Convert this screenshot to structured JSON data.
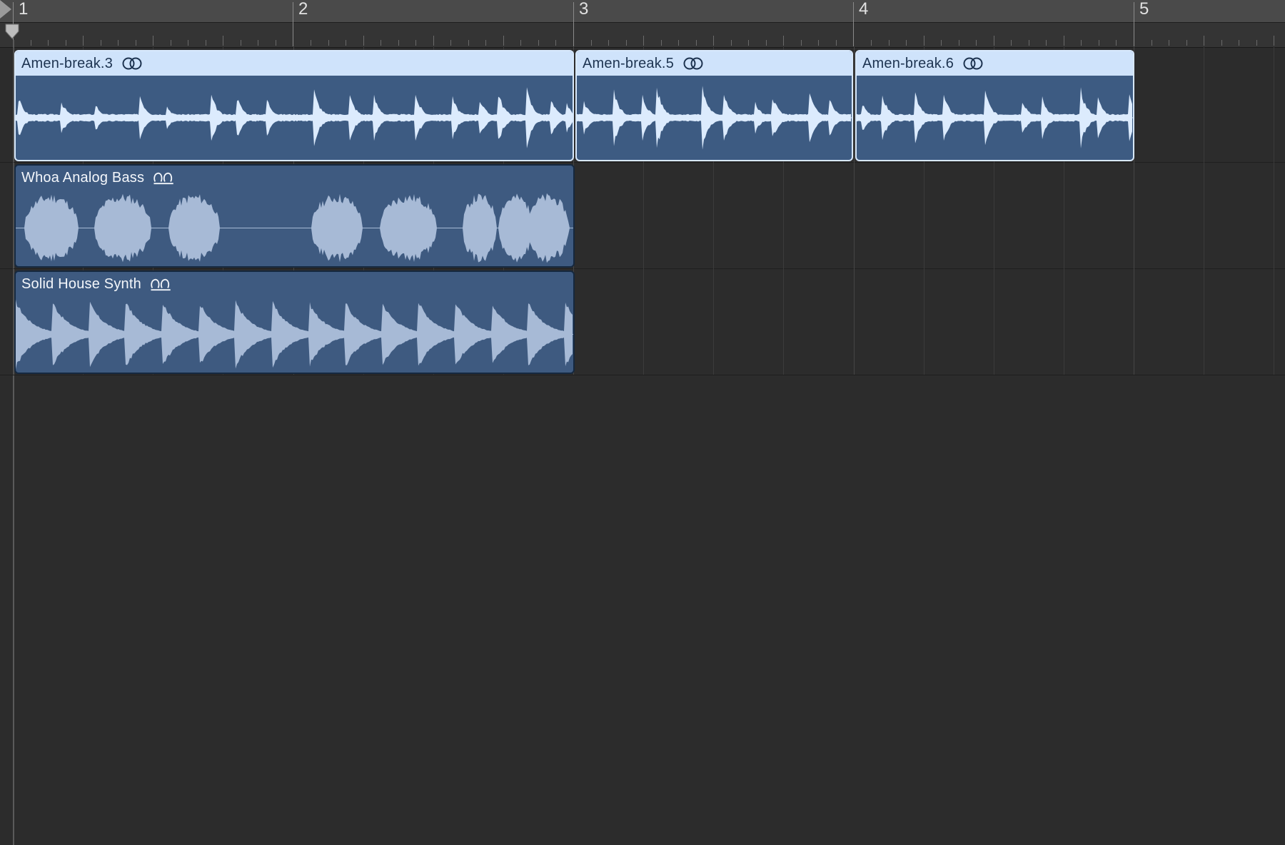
{
  "ruler": {
    "bars": [
      "1",
      "2",
      "3",
      "4",
      "5"
    ]
  },
  "tracks": [
    {
      "regions": [
        {
          "name": "Amen-break.3",
          "selected": true,
          "icon": "loop-link-icon"
        },
        {
          "name": "Amen-break.5",
          "selected": true,
          "icon": "loop-link-icon"
        },
        {
          "name": "Amen-break.6",
          "selected": true,
          "icon": "loop-link-icon"
        }
      ]
    },
    {
      "regions": [
        {
          "name": "Whoa Analog Bass",
          "selected": false,
          "icon": "apple-loop-icon"
        }
      ]
    },
    {
      "regions": [
        {
          "name": "Solid House Synth",
          "selected": false,
          "icon": "apple-loop-icon"
        }
      ]
    }
  ],
  "colors": {
    "background": "#2c2c2c",
    "region_body": "#3e5a80",
    "region_header_selected": "#cfe3fb",
    "waveform_selected": "#dcebfd",
    "waveform_plain": "#a7bad6"
  }
}
